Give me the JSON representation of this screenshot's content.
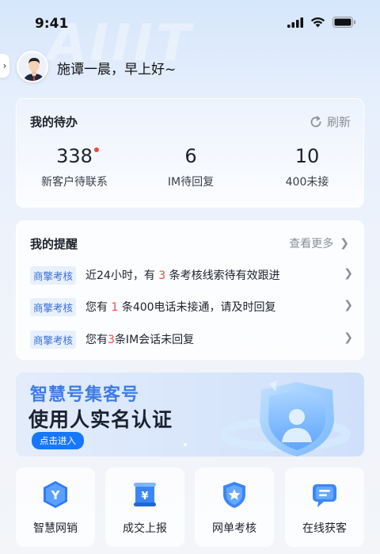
{
  "status_bar": {
    "time": "9:41"
  },
  "header": {
    "greeting": "施谭一晨，早上好~"
  },
  "todo": {
    "title": "我的待办",
    "refresh_label": "刷新",
    "stats": [
      {
        "value": "338",
        "label": "新客户待联系",
        "has_dot": true
      },
      {
        "value": "6",
        "label": "IM待回复",
        "has_dot": false
      },
      {
        "value": "10",
        "label": "400未接",
        "has_dot": false
      }
    ]
  },
  "reminders": {
    "title": "我的提醒",
    "more_label": "查看更多",
    "items": [
      {
        "tag": "商擎考核",
        "pre": "近24小时，有 ",
        "num": "3",
        "post": " 条考核线索待有效跟进"
      },
      {
        "tag": "商擎考核",
        "pre": "您有 ",
        "num": "1",
        "post": " 条400电话未接通，请及时回复"
      },
      {
        "tag": "商擎考核",
        "pre": "您有",
        "num": "3",
        "post": "条IM会话未回复"
      }
    ]
  },
  "banner": {
    "line1": "智慧号集客号",
    "line2": "使用人实名认证",
    "button": "点击进入"
  },
  "dock": {
    "items": [
      {
        "label": "智慧网销",
        "icon": "y-badge-icon"
      },
      {
        "label": "成交上报",
        "icon": "yuan-scroll-icon"
      },
      {
        "label": "网单考核",
        "icon": "star-shield-icon"
      },
      {
        "label": "在线获客",
        "icon": "chat-bubble-icon"
      }
    ]
  },
  "colors": {
    "accent": "#1677ff",
    "alert": "#f04a3c",
    "tag_bg": "#e8f0fd",
    "tag_text": "#3a6fd8"
  }
}
